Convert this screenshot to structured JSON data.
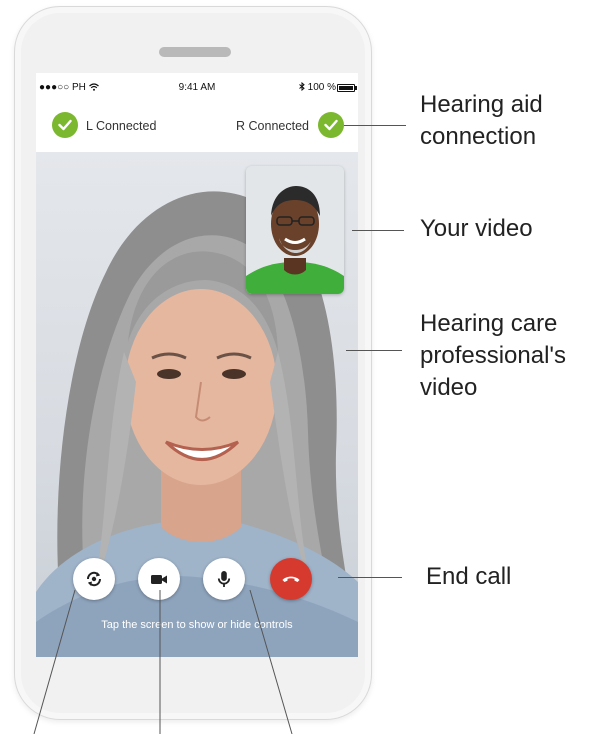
{
  "status": {
    "carrier": "●●●○○ PH",
    "time": "9:41 AM",
    "battery": "100 %"
  },
  "connection": {
    "left_label": "L Connected",
    "right_label": "R Connected"
  },
  "controls": {
    "hint": "Tap the screen to show or hide controls"
  },
  "callouts": {
    "hearing_aid_connection": "Hearing aid connection",
    "your_video": "Your video",
    "professional_video": "Hearing care professional's video",
    "end_call": "End call"
  },
  "colors": {
    "connected_green": "#7cb82f",
    "end_call_red": "#d63a2f"
  }
}
